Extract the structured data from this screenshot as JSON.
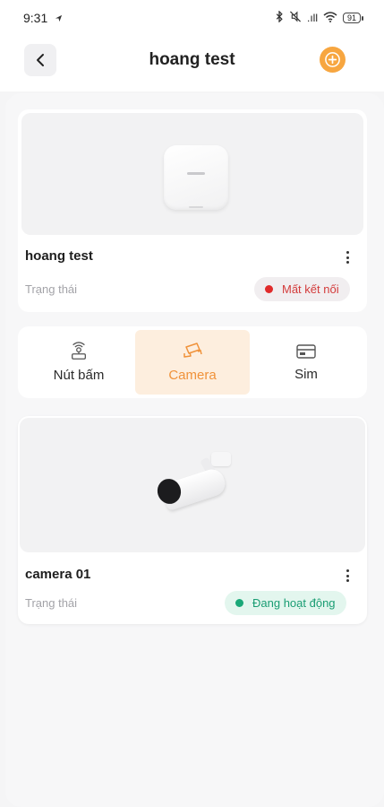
{
  "status_bar": {
    "time": "9:31",
    "signal_text": ".ıll",
    "battery": "91"
  },
  "header": {
    "title": "hoang test"
  },
  "device": {
    "name": "hoang test",
    "status_label": "Trạng thái",
    "status_value": "Mất kết nối",
    "status_color": "#d33b3b"
  },
  "tabs": [
    {
      "label": "Nút bấm",
      "icon": "router-icon",
      "active": false
    },
    {
      "label": "Camera",
      "icon": "cctv-icon",
      "active": true
    },
    {
      "label": "Sim",
      "icon": "sim-card-icon",
      "active": false
    }
  ],
  "camera": {
    "name": "camera 01",
    "status_label": "Trạng thái",
    "status_value": "Đang hoạt động",
    "status_color": "#1a9d73"
  },
  "colors": {
    "accent": "#f7a640",
    "active_tab_bg": "#fdeede"
  }
}
